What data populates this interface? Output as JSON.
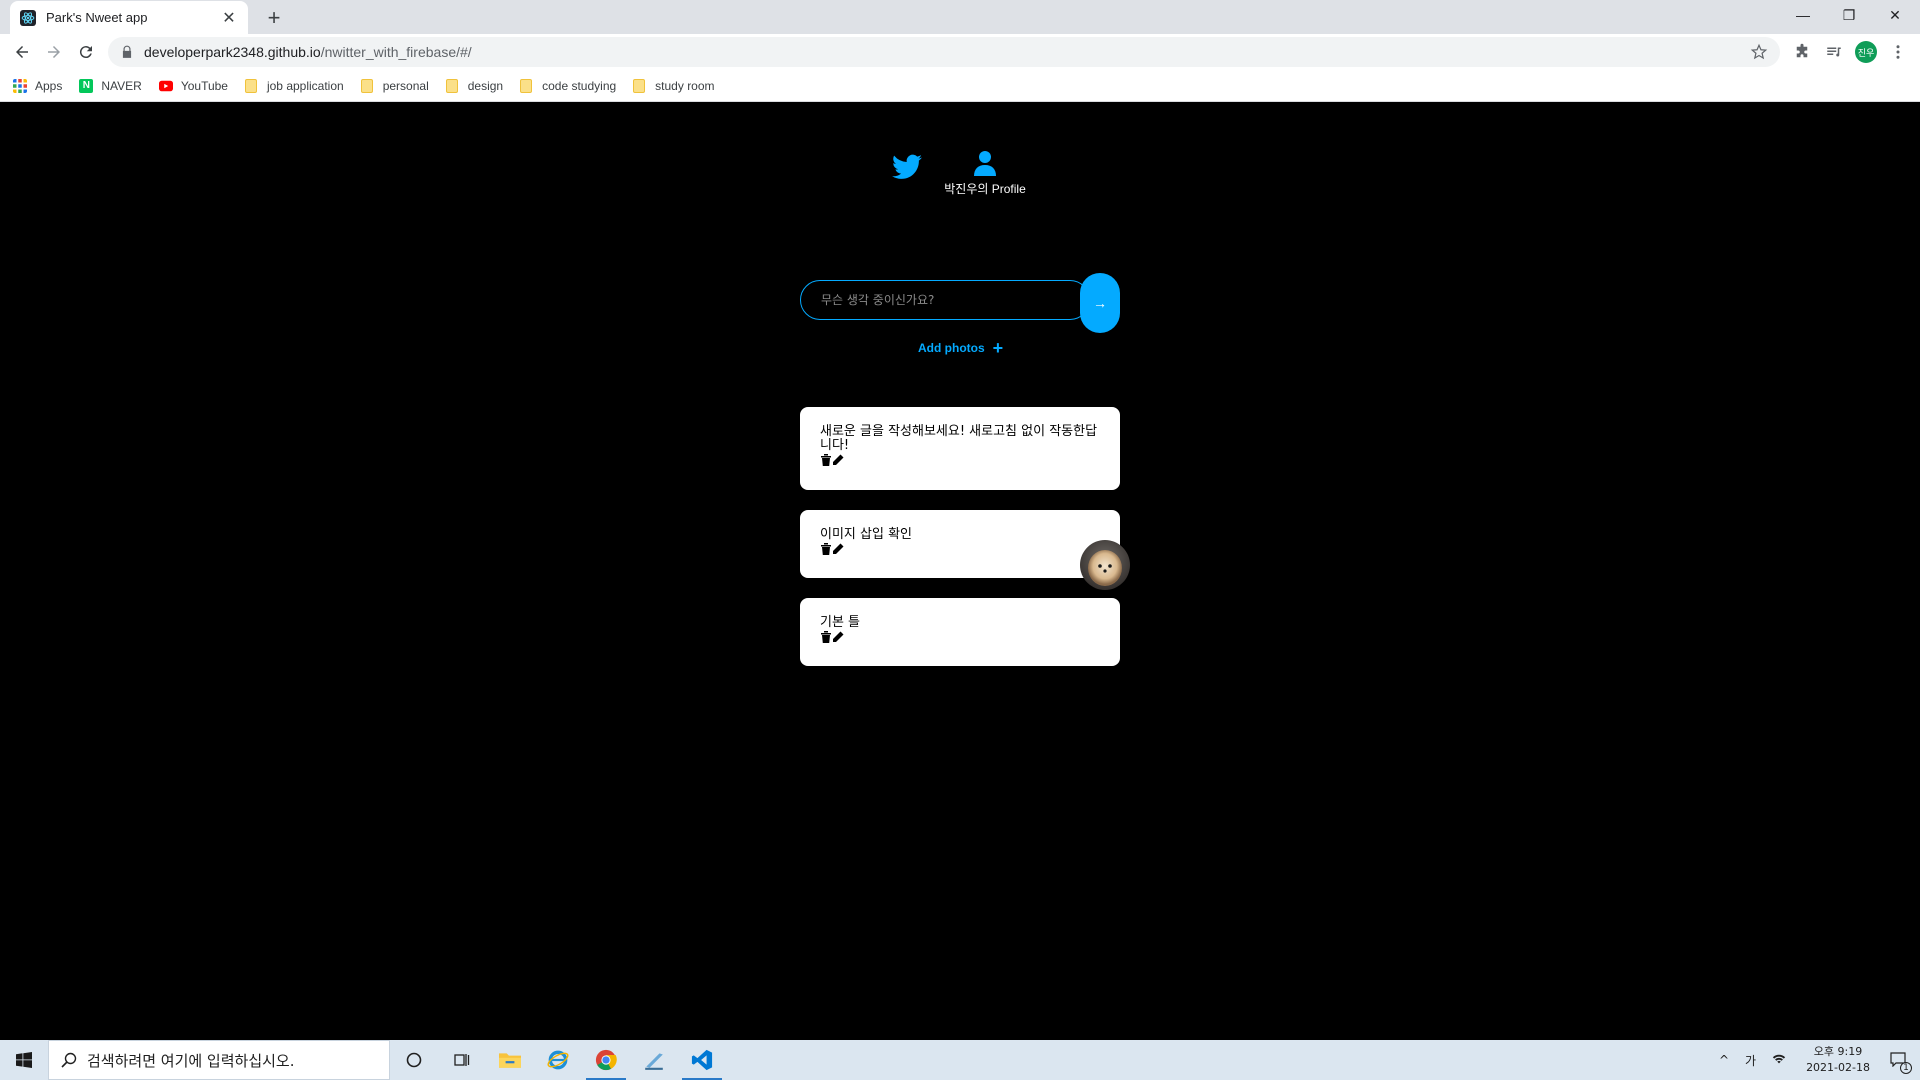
{
  "browser": {
    "tab_title": "Park's Nweet app",
    "url_host": "developerpark2348.github.io",
    "url_path": "/nwitter_with_firebase/#/",
    "profile_initials": "진우",
    "bookmarks": [
      {
        "label": "Apps",
        "icon": "apps-grid-icon"
      },
      {
        "label": "NAVER",
        "icon": "naver-icon"
      },
      {
        "label": "YouTube",
        "icon": "youtube-icon"
      },
      {
        "label": "job application",
        "icon": "folder-icon"
      },
      {
        "label": "personal",
        "icon": "folder-icon"
      },
      {
        "label": "design",
        "icon": "folder-icon"
      },
      {
        "label": "code studying",
        "icon": "folder-icon"
      },
      {
        "label": "study room",
        "icon": "folder-icon"
      }
    ]
  },
  "app": {
    "accent_color": "#04aaff",
    "nav": {
      "profile_label": "박진우의 Profile"
    },
    "composer": {
      "placeholder": "무슨 생각 중이신가요?",
      "submit_label": "→",
      "add_photos_label": "Add photos",
      "add_photos_icon": "+"
    },
    "nweets": [
      {
        "text": "새로운 글을 작성해보세요! 새로고침 없이 작동한답니다!",
        "has_image": false
      },
      {
        "text": "이미지 삽입 확인",
        "has_image": true
      },
      {
        "text": "기본 틀",
        "has_image": false
      }
    ]
  },
  "taskbar": {
    "search_placeholder": "검색하려면 여기에 입력하십시오.",
    "ime_label": "가",
    "time": "오후 9:19",
    "date": "2021-02-18",
    "notification_count": "1"
  }
}
